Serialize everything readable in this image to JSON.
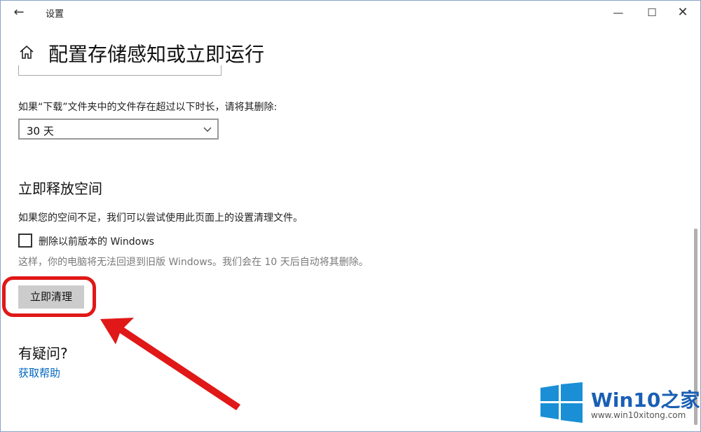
{
  "window": {
    "title": "设置",
    "back_icon": "back-arrow-icon"
  },
  "controls": {
    "minimize": "—",
    "maximize": "☐",
    "close": "✕"
  },
  "header": {
    "title": "配置存储感知或立即运行",
    "home_icon": "home-icon"
  },
  "downloads": {
    "label": "如果“下载”文件夹中的文件存在超过以下时长，请将其删除:",
    "selected_value": "30 天"
  },
  "free_space": {
    "title": "立即释放空间",
    "description": "如果您的空间不足，我们可以尝试使用此页面上的设置清理文件。",
    "checkbox_label": "删除以前版本的 Windows",
    "checkbox_checked": false,
    "note": "这样，你的电脑将无法回退到旧版 Windows。我们会在 10 天后自动将其删除。",
    "button_label": "立即清理"
  },
  "help": {
    "title": "有疑问?",
    "link": "获取帮助"
  },
  "annotation": {
    "color": "#e01818"
  },
  "watermark": {
    "brand": "Win10之家",
    "url": "www.win10xitong.com"
  },
  "colors": {
    "accent": "#0067c0",
    "button": "#cccccc",
    "logo": "#1a8fd6"
  }
}
